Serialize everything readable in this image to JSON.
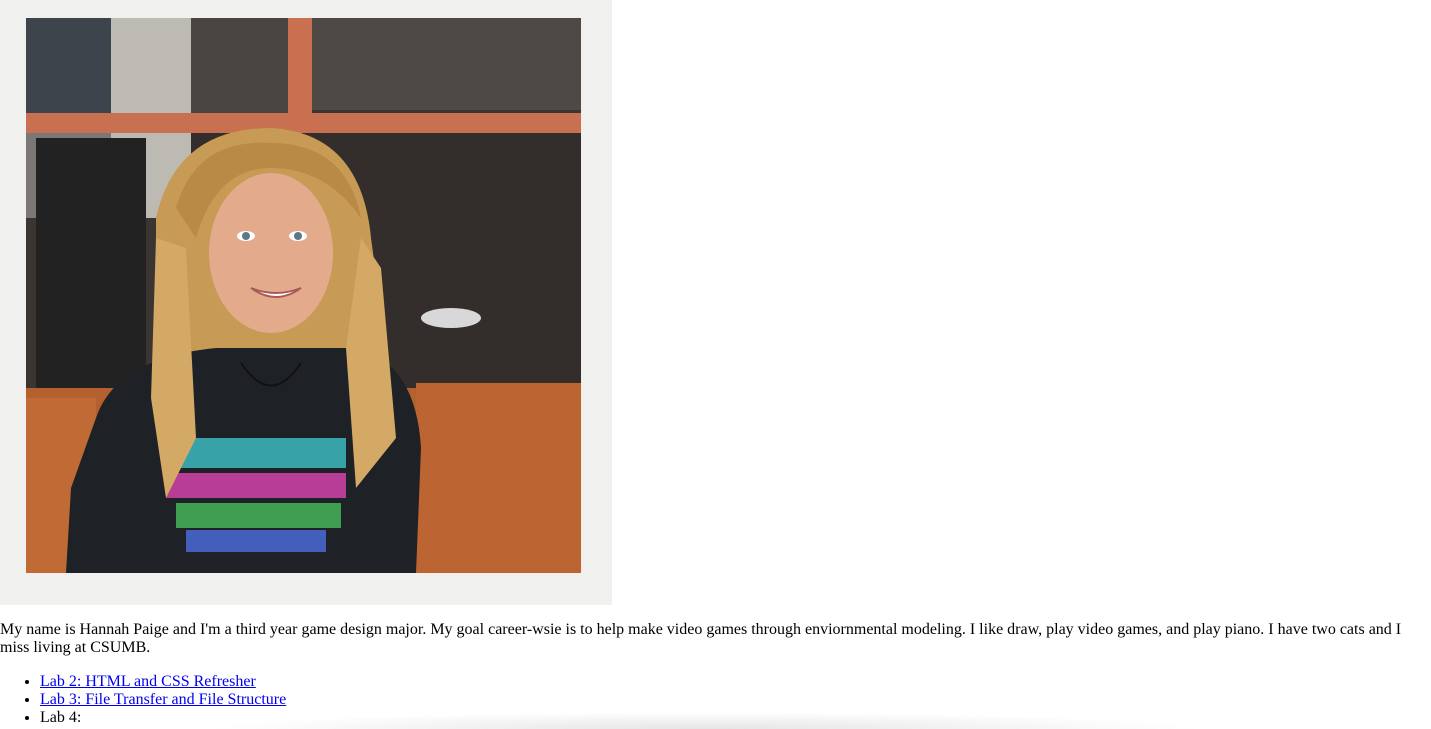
{
  "photo": {
    "alt": "Photo of Hannah Paige",
    "colors": {
      "frame": "#f0f0ee",
      "window_frame": "#c8704f",
      "couch": "#b5602f",
      "shirt": "#1e2226",
      "hair": "#c79a55",
      "skin": "#e4aa8c"
    }
  },
  "bio": {
    "text": "My name is Hannah Paige and I'm a third year game design major. My goal career-wsie is to help make video games through enviornmental modeling. I like draw, play video games, and play piano. I have two cats and I miss living at CSUMB."
  },
  "links": [
    {
      "label": "Lab 2: HTML and CSS Refresher",
      "is_link": true
    },
    {
      "label": "Lab 3: File Transfer and File Structure",
      "is_link": true
    },
    {
      "label": "Lab 4:",
      "is_link": false
    }
  ],
  "colors": {
    "link": "#0000ee",
    "text": "#000000",
    "background": "#ffffff"
  }
}
